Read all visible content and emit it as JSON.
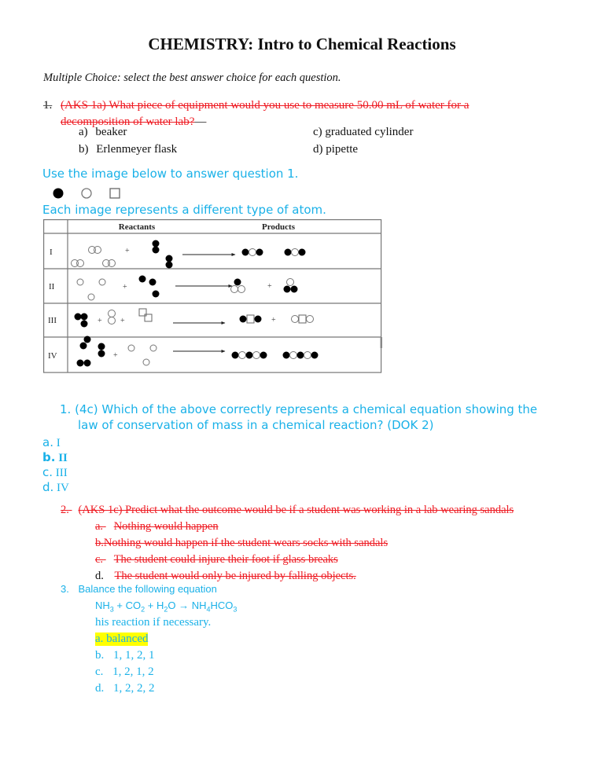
{
  "title": "CHEMISTRY: Intro to Chemical Reactions",
  "instructions": "Multiple Choice: select the best answer choice for each question.",
  "question_aks1a": {
    "number": "1.",
    "line1": "(AKS 1a) What piece of equipment would you use to measure 50.00 mL of water for a",
    "line2": "decomposition of water lab?",
    "struck": true,
    "options": [
      {
        "label": "a)",
        "text": "beaker"
      },
      {
        "label": "b)",
        "text": "Erlenmeyer flask"
      },
      {
        "label": "c)",
        "text": "graduated cylinder"
      },
      {
        "label": "d)",
        "text": "pipette"
      }
    ]
  },
  "image_prompt": "Use the image below to answer question 1.",
  "atom_legend": [
    "filled-circle-atom",
    "open-circle-atom",
    "open-square-atom"
  ],
  "atom_legend_caption": "Each image represents a different type of atom.",
  "reaction_table": {
    "headers": [
      "",
      "Reactants",
      "Products"
    ],
    "rows": [
      {
        "id": "I",
        "reactants": "3 white-white molecules + 2 black-black molecules",
        "products": "2 black-white-black molecules"
      },
      {
        "id": "II",
        "reactants": "3 white atoms + 3 black atoms",
        "products": "1 black-white-white + 1 white-black-black"
      },
      {
        "id": "III",
        "reactants": "black triad + white pair + square pair",
        "products": "black-square-black + white-square-white"
      },
      {
        "id": "IV",
        "reactants": "3 black pairs + 3 white atoms",
        "products": "2 black-white-black-white-black chains"
      }
    ]
  },
  "question_4c": {
    "number": "1.",
    "line1": "(4c) Which of the above correctly represents a chemical equation showing the",
    "line2": "law of conservation of mass in a chemical reaction? (DOK 2)",
    "options": [
      {
        "label": "a.",
        "text": "I",
        "selected": false
      },
      {
        "label": "b.",
        "text": "II",
        "selected": true
      },
      {
        "label": "c.",
        "text": "III",
        "selected": false
      },
      {
        "label": "d.",
        "text": "IV",
        "selected": false
      }
    ]
  },
  "question_aks1c": {
    "number": "2.",
    "text": "(AKS 1c) Predict what the outcome would be if a student was working in a lab wearing sandals",
    "struck": true,
    "options": [
      {
        "label": "a.",
        "text": "Nothing would happen"
      },
      {
        "label": "b.",
        "text": "Nothing would happen if the student wears socks with sandals"
      },
      {
        "label": "c.",
        "text": "The student could injure their foot if glass breaks"
      },
      {
        "label": "d.",
        "text": "The student would only be injured by falling objects."
      }
    ]
  },
  "question_balance": {
    "number": "3.",
    "text": "Balance the following equation",
    "equation": {
      "r1": "NH",
      "r1sub": "3",
      "plus1": " + ",
      "r2": "CO",
      "r2sub": "2",
      "plus2": " + ",
      "r3": "H",
      "r3sub": "2",
      "r3b": "O",
      "arrow": " → ",
      "p1": "NH",
      "p1sub": "4",
      "p1b": "HCO",
      "p1sub2": "3"
    },
    "fragment": "his reaction if necessary.",
    "options": [
      {
        "label": "a.",
        "text": "balanced",
        "highlighted": true
      },
      {
        "label": "b.",
        "text": "1, 1, 2, 1"
      },
      {
        "label": "c.",
        "text": "1, 2, 1, 2"
      },
      {
        "label": "d.",
        "text": "1, 2, 2, 2"
      }
    ]
  },
  "colors": {
    "deleted_text": "#ee1c24",
    "question_text": "#1ab1e8",
    "highlight": "#ffff00",
    "body_text": "#111111"
  }
}
